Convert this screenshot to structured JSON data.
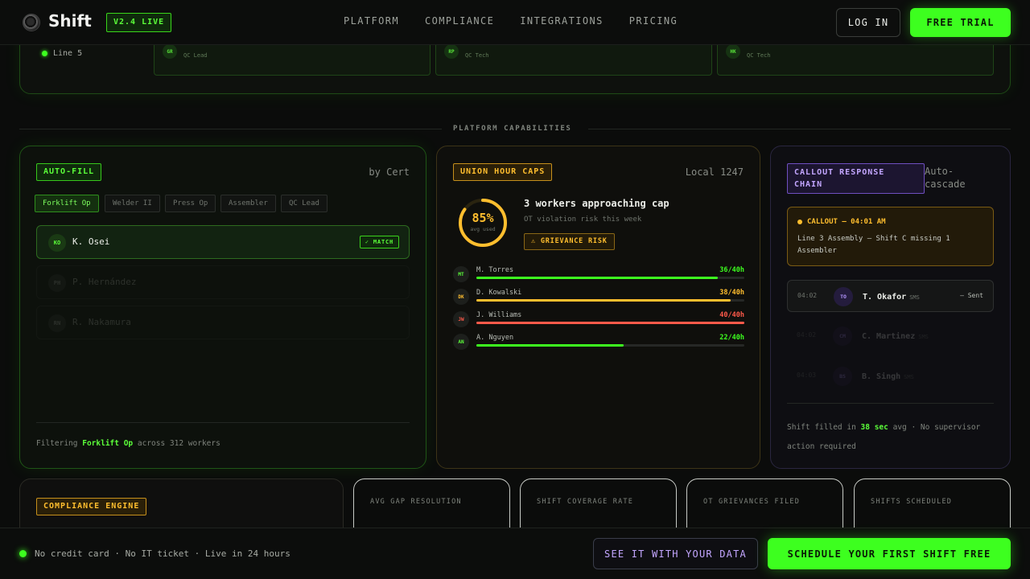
{
  "nav": {
    "brand": "Shift",
    "version_badge": "V2.4 LIVE",
    "links": [
      "PLATFORM",
      "COMPLIANCE",
      "INTEGRATIONS",
      "PRICING"
    ],
    "login_label": "LOG IN",
    "trial_label": "FREE TRIAL"
  },
  "top_panel": {
    "line_label": "Line 5",
    "qc_cards": [
      {
        "initials": "GR",
        "role": "QC Lead"
      },
      {
        "initials": "RP",
        "role": "QC Tech"
      },
      {
        "initials": "HK",
        "role": "QC Tech"
      }
    ]
  },
  "section": {
    "label": "PLATFORM CAPABILITIES"
  },
  "autofill": {
    "tag": "AUTO-FILL",
    "right_label": "by Cert",
    "chips": [
      "Forklift Op",
      "Welder II",
      "Press Op",
      "Assembler",
      "QC Lead"
    ],
    "active_chip": 0,
    "workers": [
      {
        "initials": "KO",
        "name": "K. Osei",
        "badge": "✓ MATCH"
      },
      {
        "initials": "PH",
        "name": "P. Hernández"
      },
      {
        "initials": "RN",
        "name": "R. Nakamura"
      }
    ],
    "footer_prefix": "Filtering",
    "footer_highlight": "Forklift Op",
    "footer_suffix": "across 312 workers"
  },
  "union": {
    "tag": "UNION HOUR CAPS",
    "right_label": "Local 1247",
    "ring_value": "85%",
    "ring_fraction": 0.85,
    "ring_sub": "avg used",
    "title": "3 workers approaching cap",
    "subtitle": "OT violation risk this week",
    "risk_badge": "⚠ GRIEVANCE RISK",
    "workers": [
      {
        "initials": "MT",
        "name": "M. Torres",
        "value": "36/40h",
        "fraction": 0.9,
        "color": "#3dff1f"
      },
      {
        "initials": "DK",
        "name": "D. Kowalski",
        "value": "38/40h",
        "fraction": 0.95,
        "color": "#ffbe2e"
      },
      {
        "initials": "JW",
        "name": "J. Williams",
        "value": "40/40h",
        "fraction": 1.0,
        "color": "#ff5a4a"
      },
      {
        "initials": "AN",
        "name": "A. Nguyen",
        "value": "22/40h",
        "fraction": 0.55,
        "color": "#3dff1f"
      }
    ]
  },
  "callout": {
    "tag": "CALLOUT RESPONSE CHAIN",
    "right_label": "Auto-cascade",
    "alert_title": "CALLOUT — 04:01 AM",
    "alert_text": "Line 3 Assembly — Shift C missing 1 Assembler",
    "chain": [
      {
        "time": "04:02",
        "initials": "TO",
        "name": "T. Okafor",
        "channel": "SMS",
        "status": "— Sent"
      },
      {
        "time": "04:02",
        "initials": "CM",
        "name": "C. Martinez",
        "channel": "SMS",
        "status": ""
      },
      {
        "time": "04:03",
        "initials": "BS",
        "name": "B. Singh",
        "channel": "SMS",
        "status": ""
      }
    ],
    "footer_prefix": "Shift filled in",
    "footer_highlight": "38 sec",
    "footer_suffix": "avg · No supervisor action required"
  },
  "compliance": {
    "tag": "COMPLIANCE ENGINE"
  },
  "stats": [
    "AVG GAP RESOLUTION",
    "SHIFT COVERAGE RATE",
    "OT GRIEVANCES FILED",
    "SHIFTS SCHEDULED"
  ],
  "bottom_bar": {
    "text": "No credit card · No IT ticket · Live in 24 hours",
    "see_label": "SEE IT WITH YOUR DATA",
    "schedule_label": "SCHEDULE YOUR FIRST SHIFT FREE"
  },
  "colors": {
    "accent_green": "#3dff1f",
    "accent_amber": "#ffbe2e",
    "accent_red": "#ff5a4a",
    "accent_purple": "#c3a6ff"
  }
}
